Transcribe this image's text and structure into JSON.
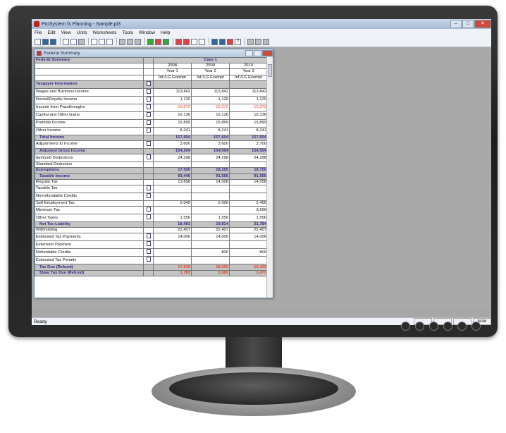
{
  "window": {
    "title": "ProSystem fx Planning - Sample.pi3"
  },
  "menu": [
    "File",
    "Edit",
    "View",
    "Units",
    "Worksheets",
    "Tools",
    "Window",
    "Help"
  ],
  "child_window": {
    "title": "Federal Summary"
  },
  "table": {
    "section_title": "Federal Summary",
    "case_label": "Case 1",
    "years": [
      "2008",
      "2009",
      "2010"
    ],
    "year_labels": [
      "Year 1",
      "Year 2",
      "Year 3"
    ],
    "col_header": [
      "Inf./LG Exempt",
      "Inf./LG Exempt",
      "Inf./LG Exempt"
    ],
    "rows": [
      {
        "label": "Taxpayer Information",
        "type": "sec",
        "icon": true,
        "values": [
          "",
          "",
          ""
        ]
      },
      {
        "label": "Wages and Business Income",
        "icon": true,
        "values": [
          "113,842",
          "113,842",
          "113,842"
        ]
      },
      {
        "label": "Rental/Royalty Income",
        "icon": true,
        "values": [
          "1,120",
          "1,120",
          "1,120"
        ]
      },
      {
        "label": "Income from Passthroughs",
        "icon": true,
        "red": true,
        "values": [
          "10,272",
          "10,272",
          "10,272"
        ]
      },
      {
        "label": "Capital and Other Gains",
        "icon": true,
        "values": [
          "16,136",
          "16,136",
          "16,136"
        ]
      },
      {
        "label": "Portfolio Income",
        "icon": true,
        "values": [
          "16,899",
          "16,899",
          "16,899"
        ]
      },
      {
        "label": "Other Income",
        "icon": true,
        "values": [
          "8,241",
          "8,241",
          "8,241"
        ]
      },
      {
        "label": "Total Income",
        "type": "tot",
        "values": [
          "157,604",
          "157,604",
          "157,604"
        ]
      },
      {
        "label": "Adjustments to Income",
        "icon": true,
        "values": [
          "3,600",
          "3,600",
          "3,700"
        ]
      },
      {
        "label": "Adjusted Gross Income",
        "type": "tot",
        "values": [
          "154,204",
          "154,004",
          "154,004"
        ]
      },
      {
        "label": "Itemized Deductions",
        "icon": true,
        "values": [
          "24,298",
          "24,298",
          "24,298"
        ]
      },
      {
        "label": "Standard Deduction",
        "icon": false,
        "values": [
          "",
          "",
          ""
        ]
      },
      {
        "label": "Exemptions",
        "type": "sec",
        "values": [
          "17,500",
          "18,250",
          "18,750"
        ]
      },
      {
        "label": "Taxable Income",
        "type": "tot",
        "values": [
          "93,446",
          "91,556",
          "91,556"
        ]
      },
      {
        "label": "Regular Tax",
        "icon": false,
        "values": [
          "13,858",
          "14,008",
          "14,058"
        ]
      },
      {
        "label": "Taxable Tax",
        "icon": true,
        "values": [
          "",
          "",
          ""
        ]
      },
      {
        "label": "Nonrefundable Credits",
        "icon": true,
        "values": [
          "",
          "",
          ""
        ]
      },
      {
        "label": "Self-Employment Tax",
        "icon": false,
        "values": [
          "2,049",
          "2,006",
          "2,456"
        ]
      },
      {
        "label": "Minimum Tax",
        "icon": true,
        "values": [
          "",
          "",
          "3,690"
        ]
      },
      {
        "label": "Other Taxes",
        "icon": true,
        "values": [
          "1,556",
          "1,556",
          "1,556"
        ]
      },
      {
        "label": "Net Tax Liability",
        "type": "tot",
        "values": [
          "18,483",
          "19,814",
          "21,784"
        ]
      },
      {
        "label": "Withholding",
        "icon": false,
        "values": [
          "22,407",
          "22,407",
          "22,407"
        ]
      },
      {
        "label": "Estimated Tax Payments",
        "icon": true,
        "values": [
          "14,006",
          "14,006",
          "14,006"
        ]
      },
      {
        "label": "Extension Payment",
        "icon": true,
        "values": [
          "",
          "",
          ""
        ]
      },
      {
        "label": "Refundable Credits",
        "icon": true,
        "values": [
          "",
          "800",
          "800"
        ]
      },
      {
        "label": "Estimated Tax Penalty",
        "icon": true,
        "values": [
          "",
          "",
          ""
        ]
      },
      {
        "label": "Tax Due (Refund)",
        "type": "tot",
        "red": true,
        "values": [
          "17,930",
          "16,599",
          "15,429"
        ]
      },
      {
        "label": "State Tax Due (Refund)",
        "type": "tot",
        "red": true,
        "values": [
          "1,782",
          "1,682",
          "1,473"
        ]
      }
    ]
  },
  "status": {
    "ready": "Ready",
    "num": "NUM"
  }
}
